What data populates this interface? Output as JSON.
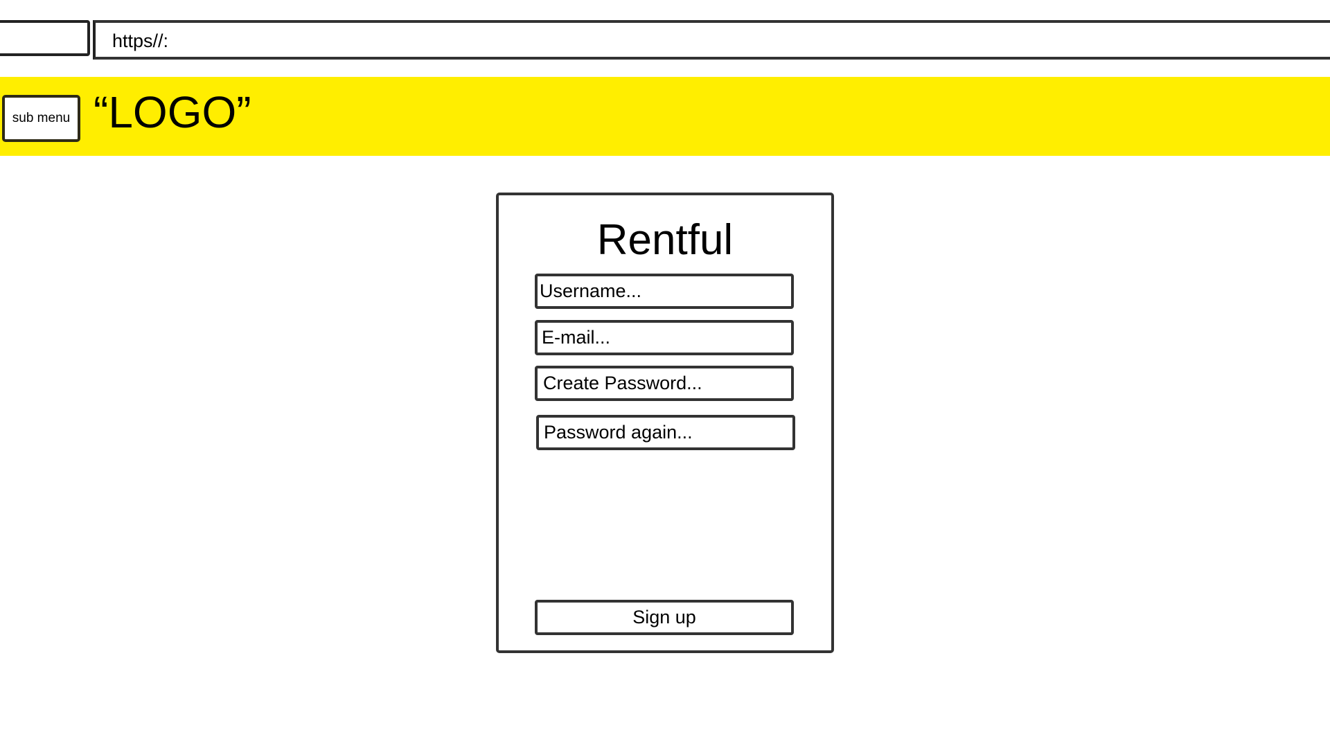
{
  "browser": {
    "url": "https//:"
  },
  "header": {
    "background_color": "#FFEE00",
    "submenu_label": "sub menu",
    "logo_text": "“LOGO”"
  },
  "signup_form": {
    "title": "Rentful",
    "username_placeholder": "Username...",
    "email_placeholder": "E-mail...",
    "create_password_placeholder": "Create Password...",
    "password_again_placeholder": "Password again...",
    "submit_label": "Sign up"
  }
}
